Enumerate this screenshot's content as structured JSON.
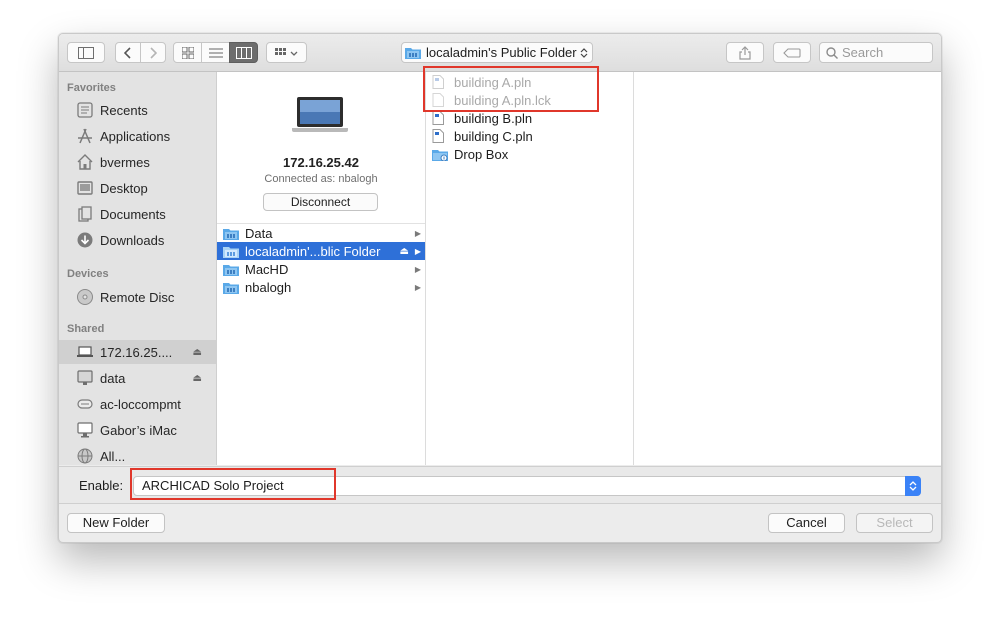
{
  "toolbar": {
    "path_label": "localadmin's Public Folder",
    "search_placeholder": "Search"
  },
  "sidebar": {
    "favorites_heading": "Favorites",
    "favorites": [
      {
        "label": "Recents",
        "icon": "recents-icon"
      },
      {
        "label": "Applications",
        "icon": "applications-icon"
      },
      {
        "label": "bvermes",
        "icon": "home-icon"
      },
      {
        "label": "Desktop",
        "icon": "desktop-icon"
      },
      {
        "label": "Documents",
        "icon": "documents-icon"
      },
      {
        "label": "Downloads",
        "icon": "downloads-icon"
      }
    ],
    "devices_heading": "Devices",
    "devices": [
      {
        "label": "Remote Disc",
        "icon": "disc-icon"
      }
    ],
    "shared_heading": "Shared",
    "shared": [
      {
        "label": "172.16.25....",
        "icon": "laptop-icon",
        "selected": true,
        "eject": true
      },
      {
        "label": "data",
        "icon": "monitor-icon",
        "eject": true
      },
      {
        "label": "ac-loccompmt",
        "icon": "server-icon"
      },
      {
        "label": "Gabor’s iMac",
        "icon": "imac-icon"
      },
      {
        "label": "All...",
        "icon": "globe-icon"
      }
    ]
  },
  "server": {
    "ip": "172.16.25.42",
    "connected_as": "Connected as: nbalogh",
    "disconnect_label": "Disconnect"
  },
  "column1": [
    {
      "label": "Data",
      "selected": false
    },
    {
      "label": "localadmin'...blic Folder",
      "selected": true,
      "eject": true
    },
    {
      "label": "MacHD",
      "selected": false
    },
    {
      "label": "nbalogh",
      "selected": false
    }
  ],
  "column2": [
    {
      "label": "building A.pln",
      "type": "document",
      "dimmed": true
    },
    {
      "label": "building A.pln.lck",
      "type": "document",
      "dimmed": true
    },
    {
      "label": "building B.pln",
      "type": "document",
      "dimmed": false
    },
    {
      "label": "building C.pln",
      "type": "document",
      "dimmed": false
    },
    {
      "label": "Drop Box",
      "type": "dropbox-folder",
      "dimmed": false
    }
  ],
  "enable": {
    "label": "Enable:",
    "value": "ARCHICAD Solo Project"
  },
  "buttons": {
    "new_folder": "New Folder",
    "cancel": "Cancel",
    "select": "Select"
  },
  "colors": {
    "selection": "#2e70d8",
    "highlight_box": "#e0372b",
    "stepper": "#3a82f7"
  }
}
